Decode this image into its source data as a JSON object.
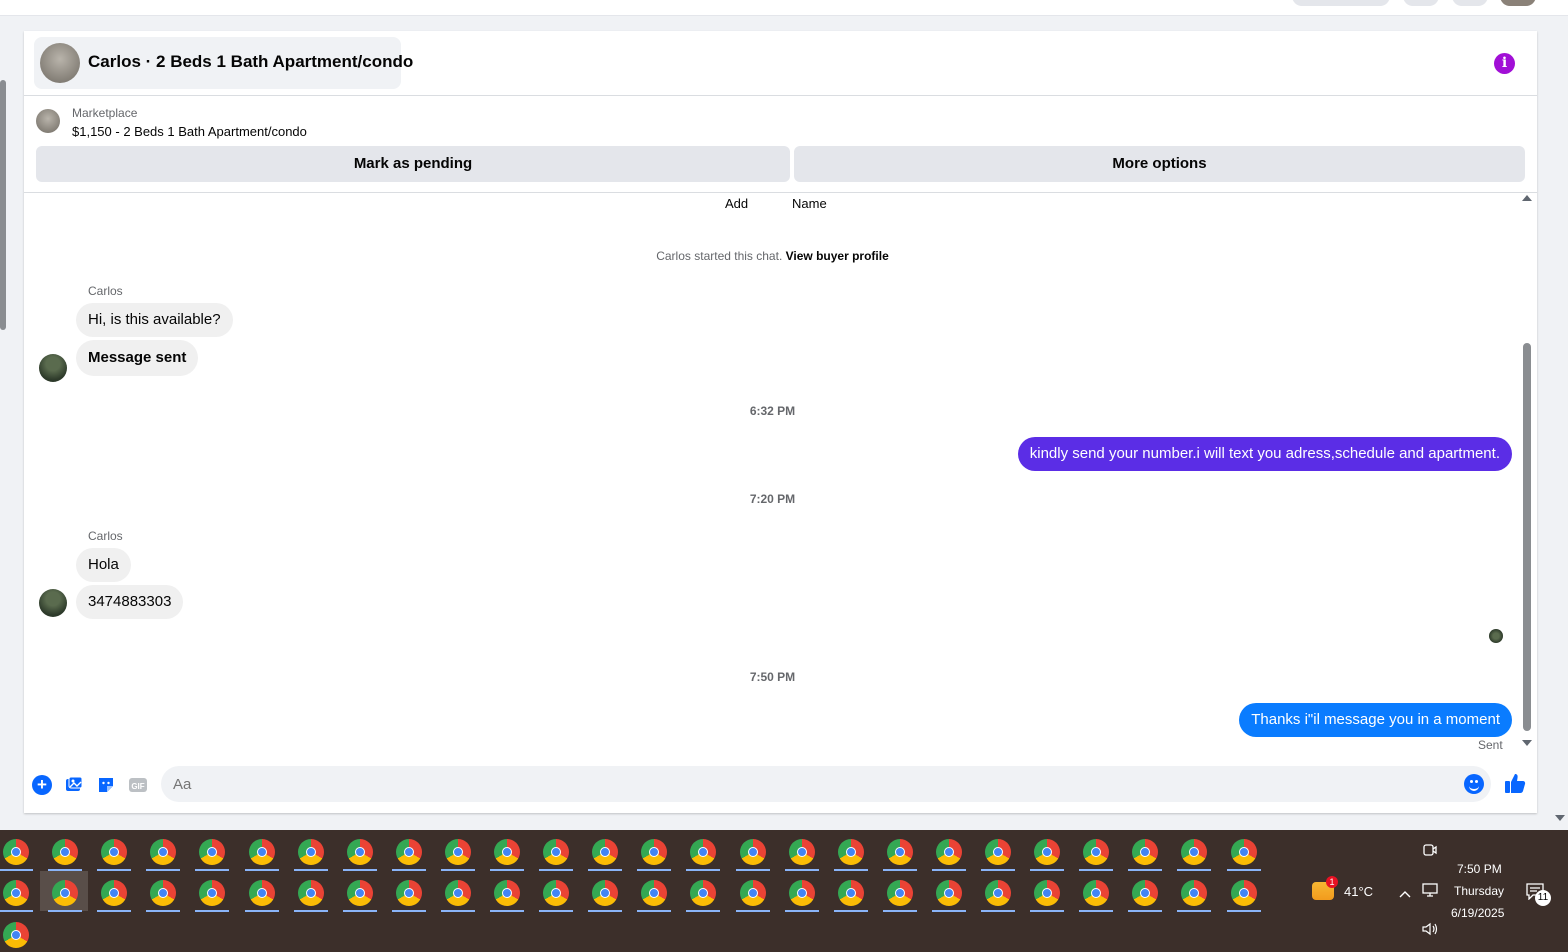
{
  "header": {
    "title": "Carlos · 2 Beds 1 Bath Apartment/condo",
    "info_icon": "info-icon"
  },
  "listing": {
    "category": "Marketplace",
    "price_title": "$1,150 - 2 Beds 1 Bath Apartment/condo",
    "mark_pending": "Mark as pending",
    "more_options": "More options"
  },
  "thread": {
    "field_labels": [
      "Add",
      "Name"
    ],
    "started_text": "Carlos started this chat.",
    "buyer_link": "View buyer profile",
    "group1": {
      "sender": "Carlos",
      "messages": [
        "Hi, is this available?",
        "Message sent"
      ]
    },
    "time1": "6:32 PM",
    "out1": "kindly send your number.i will text you adress,schedule and apartment.",
    "time2": "7:20 PM",
    "group2": {
      "sender": "Carlos",
      "messages": [
        "Hola",
        "3474883303"
      ]
    },
    "time3": "7:50 PM",
    "out2": "Thanks i\"il message you in a moment",
    "sent_label": "Sent"
  },
  "composer": {
    "placeholder": "Aa",
    "gif_label": "GIF"
  },
  "colors": {
    "out_bubble_1": "#5b2de6",
    "out_bubble_2": "#0a7cff",
    "accent": "#0866ff",
    "info": "#a10fd6"
  },
  "taskbar": {
    "temperature": "41°C",
    "weather_badge": "1",
    "time": "7:50 PM",
    "day": "Thursday",
    "date": "6/19/2025",
    "notifications": "11"
  }
}
